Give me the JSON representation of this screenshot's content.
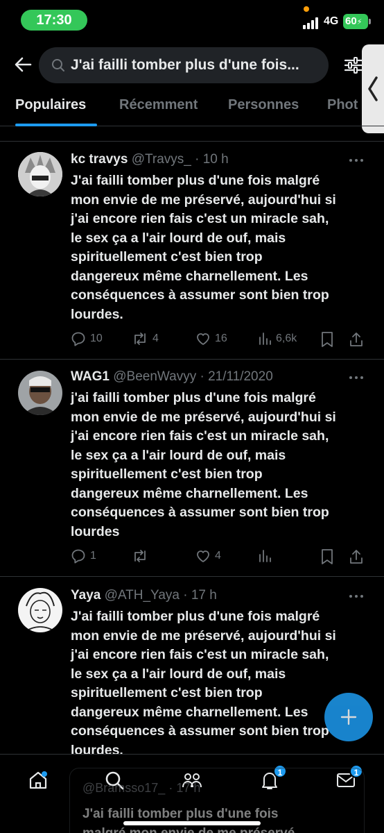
{
  "status_bar": {
    "time": "17:30",
    "network": "4G",
    "battery": "60"
  },
  "search": {
    "query": "J'ai failli tomber plus d'une fois..."
  },
  "tabs": [
    {
      "label": "Populaires",
      "active": true
    },
    {
      "label": "Récemment",
      "active": false
    },
    {
      "label": "Personnes",
      "active": false
    },
    {
      "label": "Phot",
      "active": false
    }
  ],
  "tweets": [
    {
      "name": "kc travys",
      "handle_time": "@Travys_ · 10 h",
      "lines": [
        "J'ai failli tomber plus d'une fois malgré",
        "mon envie de me préservé, aujourd'hui si",
        "j'ai encore rien fais c'est un miracle sah,",
        "le sex ça a l'air lourd de ouf, mais",
        "spirituellement c'est bien trop",
        "dangereux même charnellement. Les",
        "conséquences à assumer sont bien trop",
        "lourdes."
      ],
      "replies": "10",
      "reposts": "4",
      "likes": "16",
      "views": "6,6k"
    },
    {
      "name": "WAG1",
      "handle_time": "@BeenWavyy · 21/11/2020",
      "lines": [
        "j'ai failli tomber plus d'une fois malgré",
        "mon envie de me préservé, aujourd'hui si",
        "j'ai encore rien fais c'est un miracle sah,",
        "le sex ça a l'air lourd de ouf, mais",
        "spirituellement c'est bien trop",
        "dangereux même charnellement. Les",
        "conséquences à assumer sont bien trop",
        "lourdes"
      ],
      "replies": "1",
      "reposts": "",
      "likes": "4",
      "views": ""
    },
    {
      "name": "Yaya",
      "handle_time": "@ATH_Yaya · 17 h",
      "lines": [
        "J'ai failli tomber plus d'une fois malgré",
        "mon envie de me préservé, aujourd'hui si",
        "j'ai encore rien fais c'est un miracle sah,",
        "le sex ça a l'air lourd de ouf, mais",
        "spirituellement c'est bien trop",
        "dangereux même charnellement. Les",
        "conséquences à assumer sont bien trop",
        "lourdes."
      ]
    }
  ],
  "quoted": {
    "handle_time": "@Bramsso17_ · 17 h",
    "lines": [
      "J'ai failli tomber plus d'une fois",
      "malgré mon envie de me préservé"
    ]
  },
  "nav": {
    "notifications_badge": "1",
    "messages_badge": "1"
  },
  "colors": {
    "accent": "#1d9bf0",
    "background": "#000000",
    "muted": "#71767b",
    "text": "#e7e9ea",
    "status_green": "#34c759"
  }
}
